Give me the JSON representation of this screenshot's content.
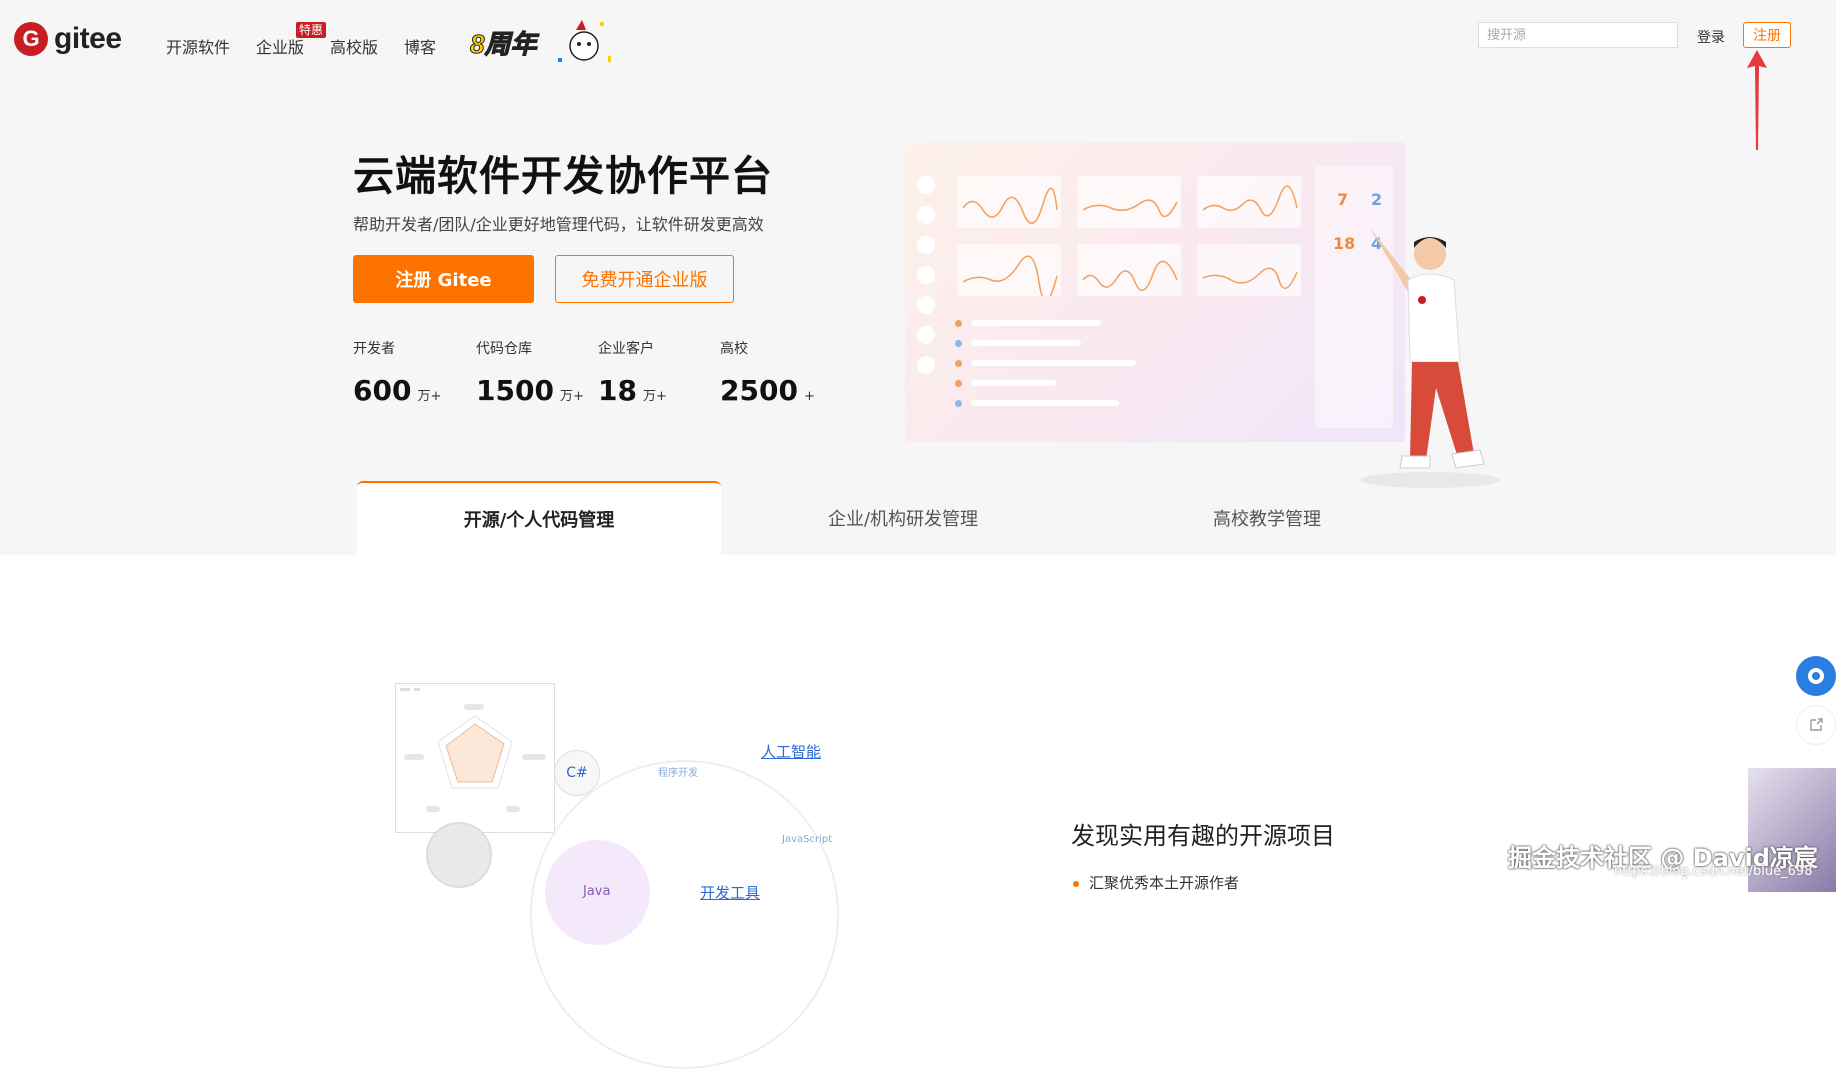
{
  "header": {
    "logo_letter": "G",
    "logo_text": "gitee",
    "nav": [
      {
        "label": "开源软件"
      },
      {
        "label": "企业版",
        "badge": "特惠"
      },
      {
        "label": "高校版"
      },
      {
        "label": "博客"
      }
    ],
    "anniversary": "8周年",
    "search_placeholder": "搜开源",
    "login": "登录",
    "register": "注册"
  },
  "hero": {
    "title": "云端软件开发协作平台",
    "subtitle": "帮助开发者/团队/企业更好地管理代码，让软件研发更高效",
    "register_button": "注册 Gitee",
    "enterprise_button": "免费开通企业版",
    "stats": [
      {
        "label": "开发者",
        "value": "600",
        "unit": "万+"
      },
      {
        "label": "代码仓库",
        "value": "1500",
        "unit": "万+"
      },
      {
        "label": "企业客户",
        "value": "18",
        "unit": "万+"
      },
      {
        "label": "高校",
        "value": "2500",
        "unit": "+"
      }
    ],
    "dashboard_numbers": [
      "7",
      "2",
      "18",
      "4"
    ]
  },
  "tabs": [
    {
      "label": "开源/个人代码管理",
      "active": true
    },
    {
      "label": "企业/机构研发管理",
      "active": false
    },
    {
      "label": "高校教学管理",
      "active": false
    }
  ],
  "section": {
    "bubbles": [
      "C#"
    ],
    "links": [
      "人工智能",
      "开发工具"
    ],
    "faint_tags": [
      "程序开发",
      "JavaScript"
    ],
    "inner_label": "Java",
    "feature_title": "发现实用有趣的开源项目",
    "feature_items": [
      "汇聚优秀本土开源作者"
    ]
  },
  "watermark": {
    "text": "掘金技术社区 @ David凉宸",
    "url": "https://blog.csdn.net/blue_698"
  },
  "colors": {
    "brand": "#c71d23",
    "accent": "#fe7300",
    "link": "#2a6ad2"
  }
}
